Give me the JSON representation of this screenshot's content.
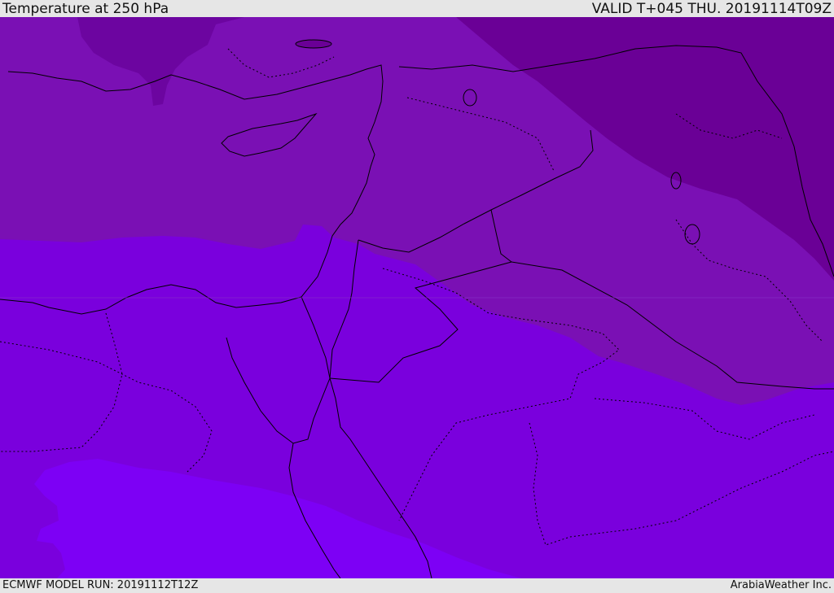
{
  "header": {
    "title": "Temperature at 250 hPa",
    "valid": "VALID T+045 THU. 20191114T09Z"
  },
  "footer": {
    "model_run": "ECMWF MODEL RUN: 20191112T12Z",
    "credit": "ArabiaWeather Inc."
  },
  "colors": {
    "band_darkest": "#6a0096",
    "band_dark": "#7a10b4",
    "band_mid": "#7a00dd",
    "band_light": "#7d00f5",
    "border": "#000000"
  }
}
